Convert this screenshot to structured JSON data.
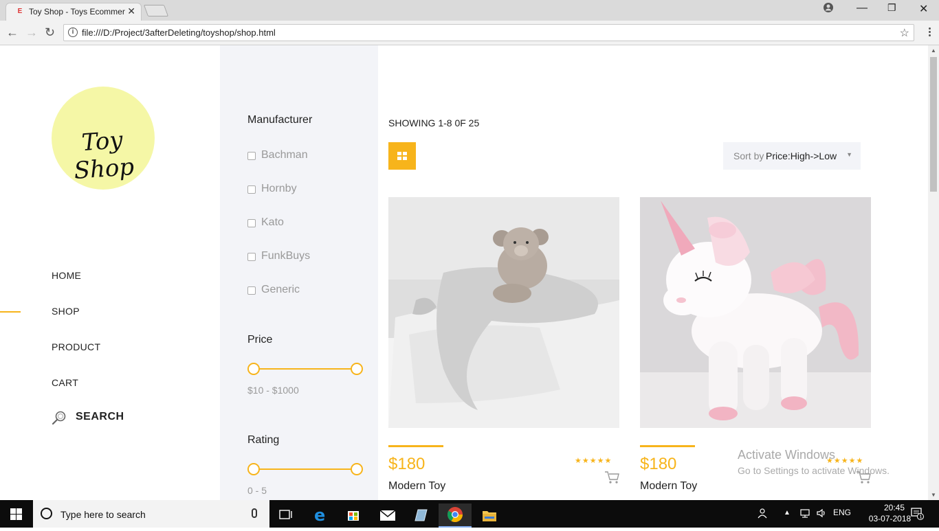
{
  "browser": {
    "tab_title": "Toy Shop - Toys Ecommerce",
    "tab_favicon": "E",
    "url": "file:///D:/Project/3afterDeleting/toyshop/shop.html"
  },
  "logo": {
    "text": "Toy Shop"
  },
  "nav": {
    "items": [
      {
        "label": "HOME",
        "active": false
      },
      {
        "label": "SHOP",
        "active": true
      },
      {
        "label": "PRODUCT",
        "active": false
      },
      {
        "label": "CART",
        "active": false
      }
    ],
    "search_label": "SEARCH"
  },
  "filters": {
    "manufacturer_heading": "Manufacturer",
    "manufacturers": [
      "Bachman",
      "Hornby",
      "Kato",
      "FunkBuys",
      "Generic"
    ],
    "price_heading": "Price",
    "price_range": "$10 - $1000",
    "rating_heading": "Rating",
    "rating_range": "0 - 5"
  },
  "listing": {
    "showing": "SHOWING 1-8 0F 25",
    "sort_prefix": "Sort by",
    "sort_value": "Price:High->Low"
  },
  "products": [
    {
      "price": "$180",
      "name": "Modern Toy",
      "stars": "★★★★★",
      "rating": 5
    },
    {
      "price": "$180",
      "name": "Modern Toy",
      "stars": "★★★★★",
      "rating": 5
    }
  ],
  "watermark": {
    "title": "Activate Windows",
    "subtitle": "Go to Settings to activate Windows."
  },
  "taskbar": {
    "search_placeholder": "Type here to search",
    "language": "ENG",
    "time": "20:45",
    "date": "03-07-2018",
    "notification_count": "1"
  },
  "colors": {
    "accent": "#f7b41b",
    "logo_bg": "#f5f7a6",
    "panel_bg": "#f3f4f8"
  }
}
